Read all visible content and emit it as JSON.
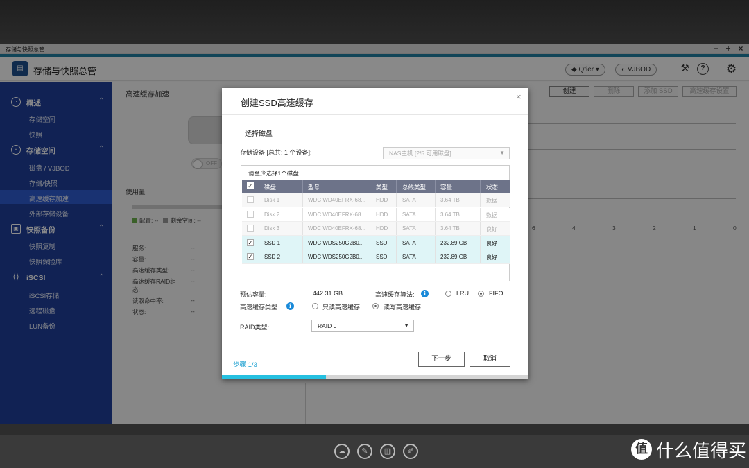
{
  "window": {
    "title": "存储与快照总管",
    "controls": [
      "−",
      "+",
      "×"
    ]
  },
  "header": {
    "app_title": "存储与快照总管",
    "qtier_label": "Qtier",
    "vjbod_label": "VJBOD"
  },
  "sidebar": {
    "groups": [
      {
        "label": "概述",
        "items": [
          "存储空间",
          "快照"
        ]
      },
      {
        "label": "存储空间",
        "items": [
          "磁盘 / VJBOD",
          "存储/快照",
          "高速缓存加速",
          "外部存储设备"
        ]
      },
      {
        "label": "快照备份",
        "items": [
          "快照复制",
          "快照保险库"
        ]
      },
      {
        "label": "iSCSI",
        "items": [
          "iSCSI存储",
          "远程磁盘",
          "LUN备份"
        ]
      }
    ],
    "active_item": "高速缓存加速"
  },
  "main": {
    "title": "高速缓存加速",
    "toolbar": {
      "create": "创建",
      "delete": "删除",
      "add_ssd": "添加 SSD",
      "cache_settings": "高速缓存设置"
    },
    "toggle": "OFF",
    "usage_title": "使用量",
    "legend": {
      "configured": "配置: --",
      "remaining": "剩余空间: --"
    },
    "info": [
      {
        "label": "服务:",
        "value": "--"
      },
      {
        "label": "容量:",
        "value": "--"
      },
      {
        "label": "高速缓存类型:",
        "value": "--"
      },
      {
        "label": "高速缓存RAID组态:",
        "value": "--"
      },
      {
        "label": "读取命中率:",
        "value": "--"
      },
      {
        "label": "状态:",
        "value": "--"
      }
    ],
    "axis_ticks": [
      "6",
      "4",
      "3",
      "2",
      "1",
      "0"
    ]
  },
  "modal": {
    "title": "创建SSD高速缓存",
    "close": "×",
    "section_title": "选择磁盘",
    "storage_label": "存储设备 [总共: 1 个设备]:",
    "storage_select": "NAS主机 [2/5 可用磁盘]",
    "table_hint": "请至少选择1个磁盘",
    "columns": [
      "磁盘",
      "型号",
      "类型",
      "总线类型",
      "容量",
      "状态"
    ],
    "rows": [
      {
        "checked": false,
        "enabled": false,
        "cells": [
          "Disk 1",
          "WDC WD40EFRX-68...",
          "HDD",
          "SATA",
          "3.64 TB",
          "数据"
        ]
      },
      {
        "checked": false,
        "enabled": false,
        "cells": [
          "Disk 2",
          "WDC WD40EFRX-68...",
          "HDD",
          "SATA",
          "3.64 TB",
          "数据"
        ]
      },
      {
        "checked": false,
        "enabled": false,
        "cells": [
          "Disk 3",
          "WDC WD40EFRX-68...",
          "HDD",
          "SATA",
          "3.64 TB",
          "良好"
        ]
      },
      {
        "checked": true,
        "enabled": true,
        "cells": [
          "SSD 1",
          "WDC WDS250G2B0...",
          "SSD",
          "SATA",
          "232.89 GB",
          "良好"
        ]
      },
      {
        "checked": true,
        "enabled": true,
        "cells": [
          "SSD 2",
          "WDC WDS250G2B0...",
          "SSD",
          "SATA",
          "232.89 GB",
          "良好"
        ]
      }
    ],
    "estimated_capacity_label": "预估容量:",
    "estimated_capacity_value": "442.31 GB",
    "algorithm_label": "高速缓存算法:",
    "algorithm_options": [
      "LRU",
      "FIFO"
    ],
    "algorithm_selected": "FIFO",
    "cache_type_label": "高速缓存类型:",
    "cache_type_options": [
      "只读高速缓存",
      "读写高速缓存"
    ],
    "cache_type_selected": "读写高速缓存",
    "raid_label": "RAID类型:",
    "raid_value": "RAID 0",
    "step_label": "步骤 1/3",
    "next_button": "下一步",
    "cancel_button": "取消",
    "progress": 0.34
  },
  "watermark": {
    "logo": "值",
    "text": "什么值得买"
  },
  "colors": {
    "sidebar": "#1f3f99",
    "sidebar_active": "#2f5bd0",
    "accent": "#26c0e0",
    "table_header": "#6d7389",
    "selected_row": "#dff5f7"
  }
}
